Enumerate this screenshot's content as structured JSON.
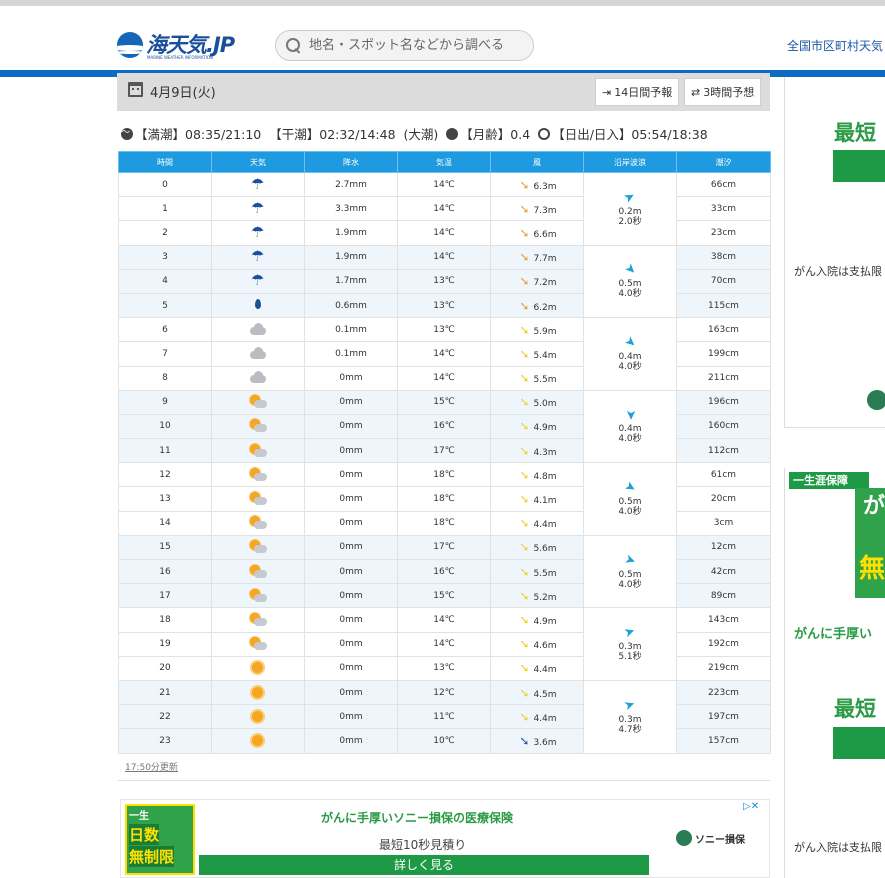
{
  "header": {
    "logo_text": "海天気.JP",
    "logo_sub": "MARINE WEATHER INFORMATION",
    "search_placeholder": "地名・スポット名などから調べる",
    "nav_link": "全国市区町村天気"
  },
  "datebar": {
    "date": "4月9日(火)",
    "btn_14day": "14日間予報",
    "btn_3hour": "3時間予想"
  },
  "tide": {
    "high": "【満潮】08:35/21:10",
    "low": "【干潮】02:32/14:48",
    "tide_type": "(大潮)",
    "moon": "【月齢】0.4",
    "sun": "【日出/日入】05:54/18:38"
  },
  "table": {
    "headers": [
      "時間",
      "天気",
      "降水",
      "気温",
      "風",
      "沿岸波浪",
      "潮汐"
    ],
    "rows": [
      {
        "hour": "0",
        "weather": "umbrella-icon",
        "precip": "2.7mm",
        "temp": "14℃",
        "wind": "6.3m",
        "wind_color": "#e8a04a",
        "tide": "66cm"
      },
      {
        "hour": "1",
        "weather": "umbrella-icon",
        "precip": "3.3mm",
        "temp": "14℃",
        "wind": "7.3m",
        "wind_color": "#e8a04a",
        "tide": "33cm"
      },
      {
        "hour": "2",
        "weather": "umbrella-icon",
        "precip": "1.9mm",
        "temp": "14℃",
        "wind": "6.6m",
        "wind_color": "#e8a04a",
        "tide": "23cm"
      },
      {
        "hour": "3",
        "weather": "umbrella-icon",
        "precip": "1.9mm",
        "temp": "14℃",
        "wind": "7.7m",
        "wind_color": "#e8a04a",
        "tide": "38cm"
      },
      {
        "hour": "4",
        "weather": "umbrella-icon",
        "precip": "1.7mm",
        "temp": "13℃",
        "wind": "7.2m",
        "wind_color": "#e8a04a",
        "tide": "70cm"
      },
      {
        "hour": "5",
        "weather": "drop-icon",
        "precip": "0.6mm",
        "temp": "13℃",
        "wind": "6.2m",
        "wind_color": "#e8a04a",
        "tide": "115cm"
      },
      {
        "hour": "6",
        "weather": "cloud-icon",
        "precip": "0.1mm",
        "temp": "13℃",
        "wind": "5.9m",
        "wind_color": "#e8d23a",
        "tide": "163cm"
      },
      {
        "hour": "7",
        "weather": "cloud-icon",
        "precip": "0.1mm",
        "temp": "14℃",
        "wind": "5.4m",
        "wind_color": "#e8d23a",
        "tide": "199cm"
      },
      {
        "hour": "8",
        "weather": "cloud-icon",
        "precip": "0mm",
        "temp": "14℃",
        "wind": "5.5m",
        "wind_color": "#e8d23a",
        "tide": "211cm"
      },
      {
        "hour": "9",
        "weather": "sun-cloud-icon",
        "precip": "0mm",
        "temp": "15℃",
        "wind": "5.0m",
        "wind_color": "#e8d23a",
        "tide": "196cm"
      },
      {
        "hour": "10",
        "weather": "sun-cloud-icon",
        "precip": "0mm",
        "temp": "16℃",
        "wind": "4.9m",
        "wind_color": "#e8d23a",
        "tide": "160cm"
      },
      {
        "hour": "11",
        "weather": "sun-cloud-icon",
        "precip": "0mm",
        "temp": "17℃",
        "wind": "4.3m",
        "wind_color": "#e8d23a",
        "tide": "112cm"
      },
      {
        "hour": "12",
        "weather": "sun-cloud-icon",
        "precip": "0mm",
        "temp": "18℃",
        "wind": "4.8m",
        "wind_color": "#e8d23a",
        "tide": "61cm"
      },
      {
        "hour": "13",
        "weather": "sun-cloud-icon",
        "precip": "0mm",
        "temp": "18℃",
        "wind": "4.1m",
        "wind_color": "#e8d23a",
        "tide": "20cm"
      },
      {
        "hour": "14",
        "weather": "sun-cloud-icon",
        "precip": "0mm",
        "temp": "18℃",
        "wind": "4.4m",
        "wind_color": "#e8d23a",
        "tide": "3cm"
      },
      {
        "hour": "15",
        "weather": "sun-cloud-icon",
        "precip": "0mm",
        "temp": "17℃",
        "wind": "5.6m",
        "wind_color": "#e8d23a",
        "tide": "12cm"
      },
      {
        "hour": "16",
        "weather": "sun-cloud-icon",
        "precip": "0mm",
        "temp": "16℃",
        "wind": "5.5m",
        "wind_color": "#e8d23a",
        "tide": "42cm"
      },
      {
        "hour": "17",
        "weather": "sun-cloud-icon",
        "precip": "0mm",
        "temp": "15℃",
        "wind": "5.2m",
        "wind_color": "#e8d23a",
        "tide": "89cm"
      },
      {
        "hour": "18",
        "weather": "sun-cloud-icon",
        "precip": "0mm",
        "temp": "14℃",
        "wind": "4.9m",
        "wind_color": "#e8d23a",
        "tide": "143cm"
      },
      {
        "hour": "19",
        "weather": "sun-cloud-icon",
        "precip": "0mm",
        "temp": "14℃",
        "wind": "4.6m",
        "wind_color": "#e8d23a",
        "tide": "192cm"
      },
      {
        "hour": "20",
        "weather": "sun-icon",
        "precip": "0mm",
        "temp": "13℃",
        "wind": "4.4m",
        "wind_color": "#e8d23a",
        "tide": "219cm"
      },
      {
        "hour": "21",
        "weather": "sun-icon",
        "precip": "0mm",
        "temp": "12℃",
        "wind": "4.5m",
        "wind_color": "#e8d23a",
        "tide": "223cm"
      },
      {
        "hour": "22",
        "weather": "sun-icon",
        "precip": "0mm",
        "temp": "11℃",
        "wind": "4.4m",
        "wind_color": "#e8d23a",
        "tide": "197cm"
      },
      {
        "hour": "23",
        "weather": "sun-icon",
        "precip": "0mm",
        "temp": "10℃",
        "wind": "3.6m",
        "wind_color": "#2a5aa8",
        "tide": "157cm"
      }
    ],
    "waves": [
      {
        "height": "0.2m",
        "period": "2.0秒"
      },
      {
        "height": "0.5m",
        "period": "4.0秒"
      },
      {
        "height": "0.4m",
        "period": "4.0秒"
      },
      {
        "height": "0.4m",
        "period": "4.0秒"
      },
      {
        "height": "0.5m",
        "period": "4.0秒"
      },
      {
        "height": "0.5m",
        "period": "4.0秒"
      },
      {
        "height": "0.3m",
        "period": "5.1秒"
      },
      {
        "height": "0.3m",
        "period": "4.7秒"
      }
    ],
    "updated": "17:50分更新"
  },
  "ad_bottom": {
    "img_line1": "一生",
    "img_line2": "日数",
    "img_line3": "無制限",
    "title": "がんに手厚いソニー損保の医療保険",
    "sub": "最短10秒見積り",
    "button": "詳しく見る",
    "logo": "ソニー損保"
  },
  "sidebar1": {
    "big": "最短",
    "text": "がん入院は支払限 安心"
  },
  "sidebar2": {
    "tag": "一生涯保障",
    "img_top": "が",
    "img_bottom": "無",
    "headline": "がんに手厚い",
    "big": "最短",
    "text": "がん入院は支払限 安心"
  },
  "colors": {
    "header_blue": "#0c6cc4",
    "table_header": "#1e9be0",
    "ad_green": "#1e9a46"
  }
}
